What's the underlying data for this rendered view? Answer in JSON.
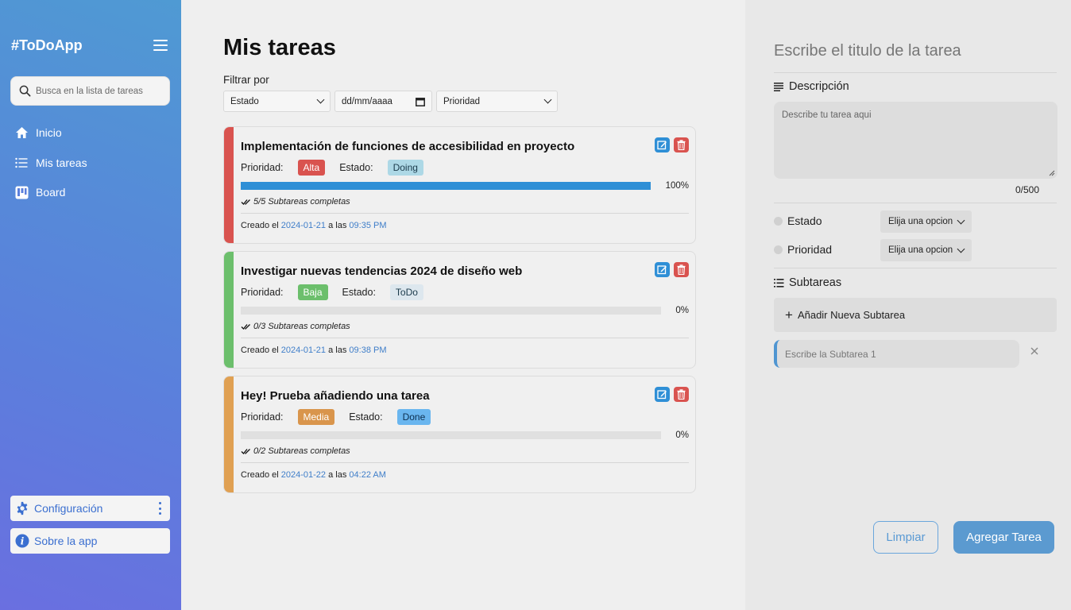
{
  "app": {
    "brand": "#ToDoApp"
  },
  "sidebar": {
    "search_placeholder": "Busca en la lista de tareas",
    "nav": [
      {
        "label": "Inicio",
        "icon": "home-icon"
      },
      {
        "label": "Mis tareas",
        "icon": "list-icon"
      },
      {
        "label": "Board",
        "icon": "board-icon"
      }
    ],
    "config_label": "Configuración",
    "about_label": "Sobre la app"
  },
  "main": {
    "title": "Mis tareas",
    "filter_label": "Filtrar por",
    "filters": {
      "estado": "Estado",
      "fecha": "dd/mm/aaaa",
      "prioridad": "Prioridad"
    },
    "priority_label": "Prioridad:",
    "status_label": "Estado:",
    "created_prefix": "Creado el",
    "created_mid": "a las",
    "tasks": [
      {
        "title": "Implementación de funciones de accesibilidad en proyecto",
        "priority": "Alta",
        "status": "Doing",
        "progress": 100,
        "progress_label": "100%",
        "subtasks": "5/5 Subtareas completas",
        "date": "2024-01-21",
        "time": "09:35 PM",
        "stripe_color": "#d9534f",
        "priority_color": "#d9534f",
        "priority_text_color": "#ffffff",
        "status_bg": "#add8e6",
        "status_color": "#1b3a4b"
      },
      {
        "title": "Investigar nuevas tendencias 2024 de diseño web",
        "priority": "Baja",
        "status": "ToDo",
        "progress": 0,
        "progress_label": "0%",
        "subtasks": "0/3 Subtareas completas",
        "date": "2024-01-21",
        "time": "09:38 PM",
        "stripe_color": "#6cbf6c",
        "priority_color": "#6cbf6c",
        "priority_text_color": "#ffffff",
        "status_bg": "#dde7ee",
        "status_color": "#1b3a4b"
      },
      {
        "title": "Hey! Prueba añadiendo una tarea",
        "priority": "Media",
        "status": "Done",
        "progress": 0,
        "progress_label": "0%",
        "subtasks": "0/2 Subtareas completas",
        "date": "2024-01-22",
        "time": "04:22 AM",
        "stripe_color": "#e0a052",
        "priority_color": "#d9954c",
        "priority_text_color": "#ffffff",
        "status_bg": "#6ab6ef",
        "status_color": "#0d2f4f"
      }
    ]
  },
  "panel": {
    "title_placeholder": "Escribe el titulo de la tarea",
    "description_label": "Descripción",
    "description_placeholder": "Describe tu tarea aqui",
    "counter": "0/500",
    "estado_label": "Estado",
    "prioridad_label": "Prioridad",
    "select_placeholder": "Elija una opcion",
    "subtasks_label": "Subtareas",
    "add_subtask": "Añadir Nueva Subtarea",
    "subtask_placeholder": "Escribe la Subtarea 1",
    "clear_button": "Limpiar",
    "add_button": "Agregar Tarea"
  },
  "colors": {
    "accent": "#5b9ad0",
    "edit_icon": "#2f8fd6",
    "delete_icon": "#d9534f"
  }
}
